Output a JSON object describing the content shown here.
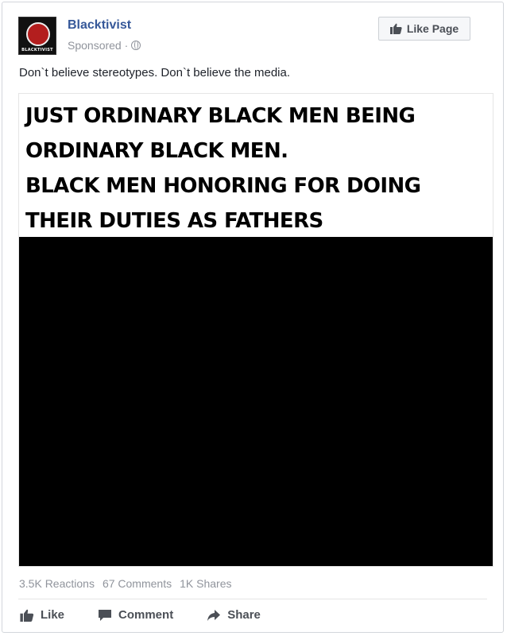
{
  "post": {
    "page_name": "Blacktivist",
    "avatar_caption": "BLACKTIVIST",
    "sponsored": "Sponsored ·",
    "like_page_label": "Like Page",
    "text": "Don`t believe stereotypes. Don`t believe the media.",
    "image_headline": "JUST ORDINARY BLACK MEN BEING\nORDINARY BLACK MEN.\nBLACK MEN HONORING FOR DOING\nTHEIR DUTIES AS FATHERS"
  },
  "stats": {
    "reactions": "3.5K Reactions",
    "comments": "67 Comments",
    "shares": "1K Shares"
  },
  "actions": {
    "like": "Like",
    "comment": "Comment",
    "share": "Share"
  },
  "colors": {
    "link_blue": "#365899",
    "muted_gray": "#90949c",
    "action_gray": "#4b4f56"
  },
  "icons": [
    "globe-icon",
    "thumbs-up-icon",
    "comment-icon",
    "share-arrow-icon"
  ]
}
